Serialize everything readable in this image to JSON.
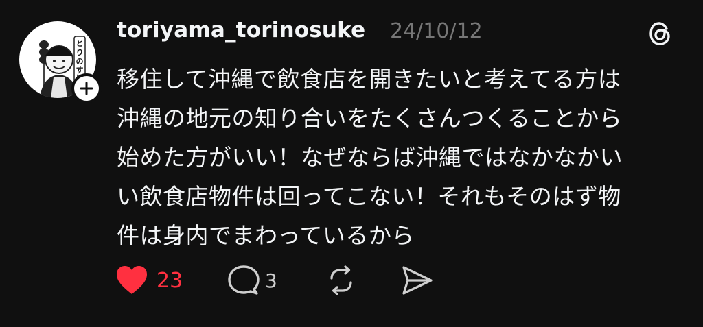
{
  "post": {
    "username": "toriyama_torinosuke",
    "date": "24/10/12",
    "lines": [
      "移住して沖縄で飲食店を開きたいと考えてる方は",
      "沖縄の地元の知り合いをたくさんつくることから",
      "始めた方がいい！なぜならば沖縄ではなかなかい",
      "い飲食店物件は回ってこない！それもそのはず物",
      "件は身内でまわっているから"
    ],
    "avatar_lettering": "とりのすけ"
  },
  "actions": {
    "like_count": "23",
    "reply_count": "3"
  },
  "icons": {
    "like": "heart-icon",
    "reply": "speech-bubble-icon",
    "repost": "repost-icon",
    "share": "send-icon",
    "brand": "threads-logo-icon",
    "follow": "plus-icon"
  },
  "colors": {
    "background": "#101010",
    "text": "#f3f5f7",
    "secondary": "#777777",
    "like": "#ff3040"
  }
}
